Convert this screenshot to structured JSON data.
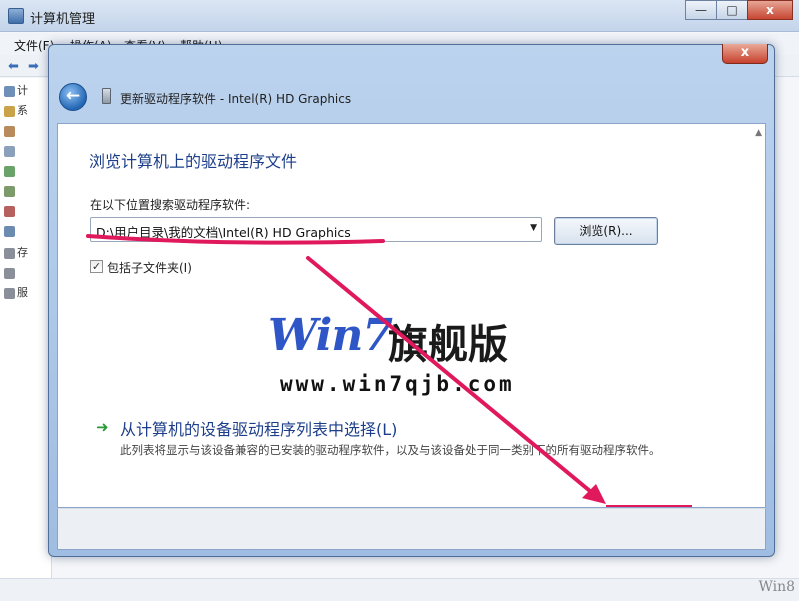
{
  "background_window": {
    "title": "计算机管理",
    "menu": [
      "文件(F)",
      "操作(A)",
      "查看(V)",
      "帮助(H)"
    ],
    "tree_labels": [
      "计",
      "系",
      "存",
      "服"
    ],
    "window_buttons": {
      "minimize": "—",
      "maximize": "□",
      "close": "x"
    }
  },
  "dialog": {
    "title": "更新驱动程序软件 - Intel(R) HD Graphics",
    "close_label": "x",
    "heading": "浏览计算机上的驱动程序文件",
    "search_label": "在以下位置搜索驱动程序软件:",
    "path_value": "D:\\用户目录\\我的文档\\Intel(R) HD Graphics",
    "browse_button": "浏览(R)...",
    "include_subfolders_label": "包括子文件夹(I)",
    "include_subfolders_checked": true,
    "option_title": "从计算机的设备驱动程序列表中选择(L)",
    "option_desc": "此列表将显示与该设备兼容的已安装的驱动程序软件，以及与该设备处于同一类别下的所有驱动程序软件。"
  },
  "watermark": {
    "logo": "Win7",
    "logo_cn": "旗舰版",
    "url": "www.win7qjb.com"
  },
  "corner_watermark": "Win8",
  "colors": {
    "heading_blue": "#1d3f8a",
    "annotation_pink": "#e0195c",
    "green_arrow": "#2b9a36"
  }
}
